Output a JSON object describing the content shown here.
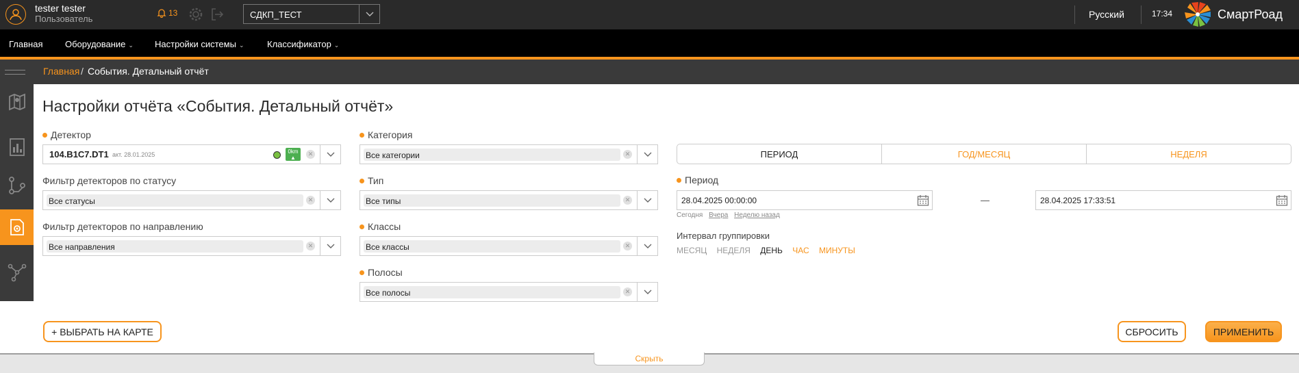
{
  "user": {
    "name": "tester tester",
    "role": "Пользователь"
  },
  "notifications": {
    "count": "13"
  },
  "org_select": {
    "value": "СДКП_ТЕСТ"
  },
  "language": "Русский",
  "clock": "17:34",
  "brand": "СмартРоад",
  "nav": [
    {
      "label": "Главная"
    },
    {
      "label": "Оборудование"
    },
    {
      "label": "Настройки системы"
    },
    {
      "label": "Классификатор"
    }
  ],
  "breadcrumb": {
    "home": "Главная",
    "separator": "/",
    "current": "События. Детальный отчёт"
  },
  "page_title": "Настройки отчёта «События. Детальный отчёт»",
  "fields": {
    "detector": {
      "label": "Детектор",
      "value": "104.B1C7.DT1",
      "date": "акт. 28.01.2025",
      "badge_top": "0km",
      "badge_bottom": "▲"
    },
    "status_filter": {
      "label": "Фильтр детекторов по статусу",
      "value": "Все статусы"
    },
    "direction_filter": {
      "label": "Фильтр детекторов по направлению",
      "value": "Все направления"
    },
    "category": {
      "label": "Категория",
      "value": "Все категории"
    },
    "type": {
      "label": "Тип",
      "value": "Все типы"
    },
    "classes": {
      "label": "Классы",
      "value": "Все классы"
    },
    "lanes": {
      "label": "Полосы",
      "value": "Все полосы"
    }
  },
  "period_tabs": [
    {
      "label": "ПЕРИОД",
      "active": true
    },
    {
      "label": "ГОД/МЕСЯЦ",
      "active": false
    },
    {
      "label": "НЕДЕЛЯ",
      "active": false
    }
  ],
  "period": {
    "label": "Период",
    "from": "28.04.2025 00:00:00",
    "dash": "—",
    "to": "28.04.2025 17:33:51",
    "quick": [
      "Сегодня",
      "Вчера",
      "Неделю назад"
    ]
  },
  "grouping": {
    "label": "Интервал группировки",
    "options": [
      "МЕСЯЦ",
      "НЕДЕЛЯ",
      "ДЕНЬ",
      "ЧАС",
      "МИНУТЫ"
    ],
    "selected": "ДЕНЬ"
  },
  "buttons": {
    "map": "+ ВЫБРАТЬ НА КАРТЕ",
    "reset": "СБРОСИТЬ",
    "apply": "ПРИМЕНИТЬ"
  },
  "hide": "Скрыть",
  "colors": {
    "accent": "#f7941d",
    "topbar": "#2a2a2a",
    "navbar": "#000000",
    "sidebar": "#3a3a3a",
    "ok_status": "#7ac142"
  }
}
